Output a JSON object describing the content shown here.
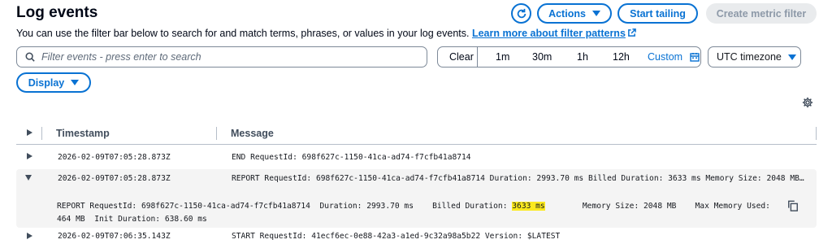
{
  "header": {
    "title": "Log events",
    "description": "You can use the filter bar below to search for and match terms, phrases, or values in your log events.",
    "learn_more": "Learn more about filter patterns"
  },
  "toolbar": {
    "actions_label": "Actions",
    "start_tailing_label": "Start tailing",
    "create_metric_filter_label": "Create metric filter"
  },
  "search": {
    "placeholder": "Filter events - press enter to search"
  },
  "time_range": {
    "clear": "Clear",
    "options": [
      "1m",
      "30m",
      "1h",
      "12h"
    ],
    "custom": "Custom"
  },
  "timezone": {
    "selected": "UTC timezone"
  },
  "display": {
    "label": "Display"
  },
  "table": {
    "headers": {
      "timestamp": "Timestamp",
      "message": "Message"
    },
    "rows": [
      {
        "timestamp": "2026-02-09T07:05:28.873Z",
        "message": "END RequestId: 698f627c-1150-41ca-ad74-f7cfb41a8714"
      },
      {
        "timestamp": "2026-02-09T07:05:28.873Z",
        "message": "REPORT RequestId: 698f627c-1150-41ca-ad74-f7cfb41a8714 Duration: 2993.70 ms Billed Duration: 3633 ms Memory Size: 2048 MB Max Mem..."
      },
      {
        "timestamp": "2026-02-09T07:06:35.143Z",
        "message": "START RequestId: 41ecf6ec-0e88-42a3-a1ed-9c32a98a5b22 Version: $LATEST"
      }
    ],
    "expanded_detail": {
      "before": "REPORT RequestId: 698f627c-1150-41ca-ad74-f7cfb41a8714  Duration: 2993.70 ms    Billed Duration: ",
      "highlight": "3633 ms",
      "after": "        Memory Size: 2048 MB    Max Memory Used:\n464 MB  Init Duration: 638.60 ms"
    }
  },
  "colors": {
    "accent": "#0972d3",
    "highlight": "#fbe91e",
    "disabled_bg": "#e9ebed"
  }
}
